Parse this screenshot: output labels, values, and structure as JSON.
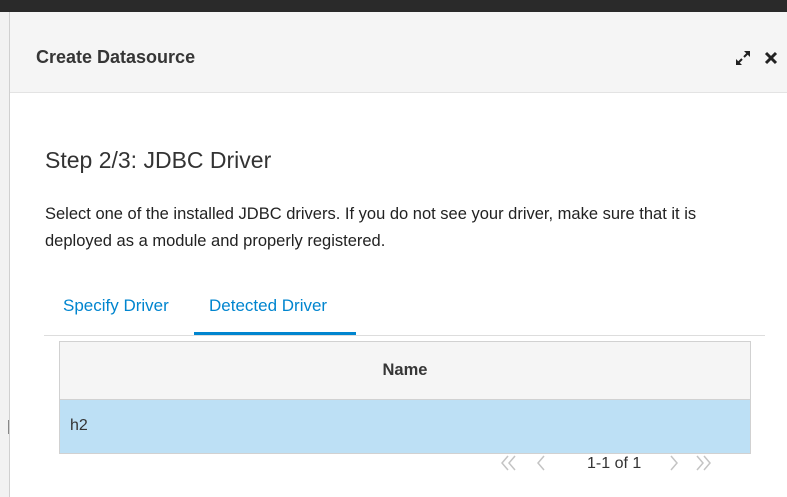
{
  "dialog": {
    "title": "Create Datasource",
    "maximize_icon": "expand-arrows-icon",
    "close_icon": "close-x-icon"
  },
  "step": {
    "title": "Step 2/3: JDBC Driver",
    "description": "Select one of the installed JDBC drivers. If you do not see your driver, make sure that it is deployed as a module and properly registered."
  },
  "tabs": [
    {
      "label": "Specify Driver",
      "active": false
    },
    {
      "label": "Detected Driver",
      "active": true
    }
  ],
  "table": {
    "columns": [
      "Name"
    ],
    "rows": [
      {
        "name": "h2",
        "selected": true
      }
    ]
  },
  "pager": {
    "first_icon": "double-chevron-left-icon",
    "prev_icon": "chevron-left-icon",
    "label": "1-1 of 1",
    "next_icon": "chevron-right-icon",
    "last_icon": "double-chevron-right-icon"
  },
  "colors": {
    "accent": "#0085cf",
    "selected_row": "#bde0f5",
    "header_bg": "#f5f5f5"
  }
}
